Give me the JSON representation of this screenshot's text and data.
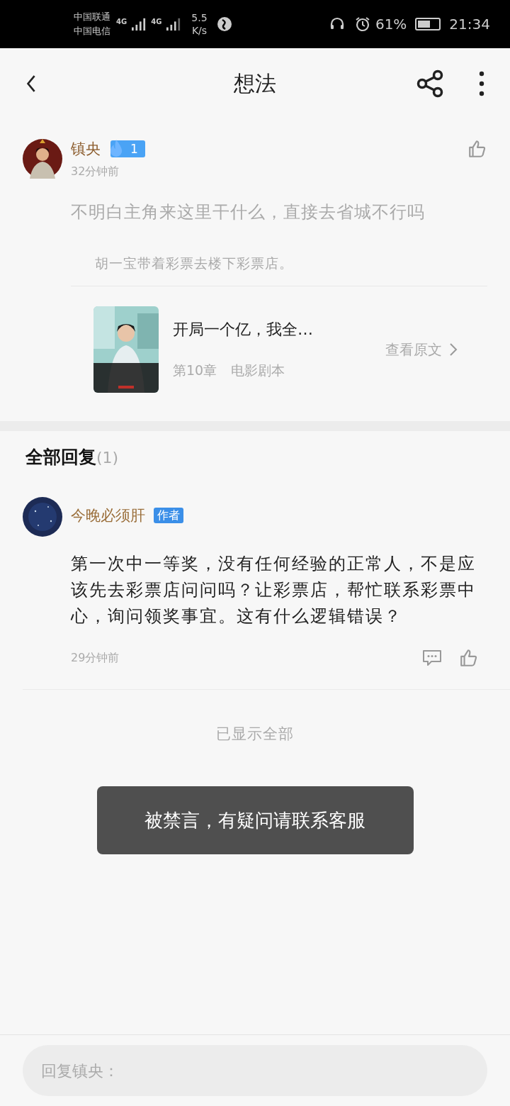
{
  "status_bar": {
    "carrier_1": "中国联通",
    "carrier_2": "中国电信",
    "network_1": "4G",
    "network_2": "4G",
    "speed_value": "5.5",
    "speed_unit": "K/s",
    "battery": "61%",
    "time": "21:34"
  },
  "header": {
    "title": "想法"
  },
  "post": {
    "author": "镇央",
    "fan_level": "1",
    "time": "32分钟前",
    "liked": false,
    "text": "不明白主角来这里干什么，直接去省城不行吗",
    "quote": "胡一宝带着彩票去楼下彩票店。",
    "book": {
      "title": "开局一个亿，我全…",
      "chapter": "第10章",
      "chapter_title": "电影剧本",
      "link": "查看原文"
    }
  },
  "replies_header": {
    "title": "全部回复",
    "count": "(1)"
  },
  "replies": [
    {
      "author": "今晚必须肝",
      "badge": "作者",
      "text": "第一次中一等奖，没有任何经验的正常人，不是应该先去彩票店问问吗？让彩票店，帮忙联系彩票中心，询问领奖事宜。这有什么逻辑错误？",
      "time": "29分钟前",
      "liked": false
    }
  ],
  "end_note": "已显示全部",
  "toast": "被禁言，有疑问请联系客服",
  "reply_input": {
    "placeholder": "回复镇央："
  }
}
